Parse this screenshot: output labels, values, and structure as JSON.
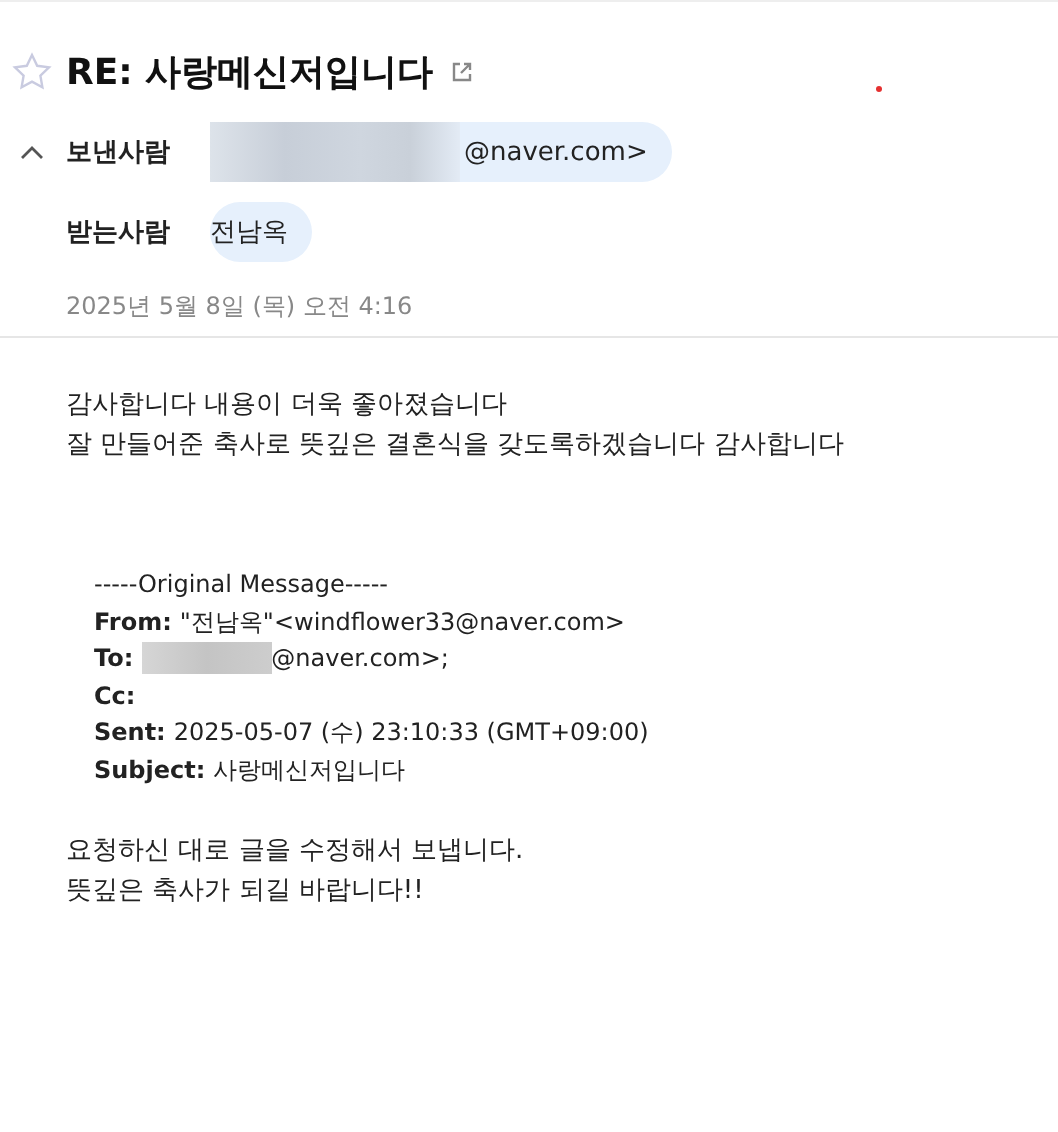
{
  "subject": "RE: 사랑메신저입니다",
  "starred": false,
  "header_expanded": true,
  "sender": {
    "label": "보낸사람",
    "redacted": true,
    "address": "@naver.com>"
  },
  "recipient": {
    "label": "받는사람",
    "name": "전남옥"
  },
  "date": "2025년 5월 8일 (목) 오전 4:16",
  "body": [
    "감사합니다 내용이 더욱 좋아졌습니다",
    "잘 만들어준 축사로 뜻깊은 결혼식을 갖도록하겠습니다 감사합니다"
  ],
  "original": {
    "title": "-----Original Message-----",
    "headers": [
      {
        "label": "From:",
        "redacted": false,
        "value": "\"전남옥\"<windflower33@naver.com>"
      },
      {
        "label": "To:",
        "redacted": true,
        "value": "@naver.com>;"
      },
      {
        "label": "Cc:",
        "redacted": false
      },
      {
        "label": "Sent:",
        "redacted": false,
        "value": "2025-05-07 (수) 23:10:33 (GMT+09:00)"
      },
      {
        "label": "Subject:",
        "redacted": false,
        "value": "사랑메신저입니다"
      }
    ]
  },
  "footer": [
    "요청하신 대로 글을 수정해서 보냅니다.",
    "뜻깊은 축사가 되길 바랍니다!!"
  ]
}
